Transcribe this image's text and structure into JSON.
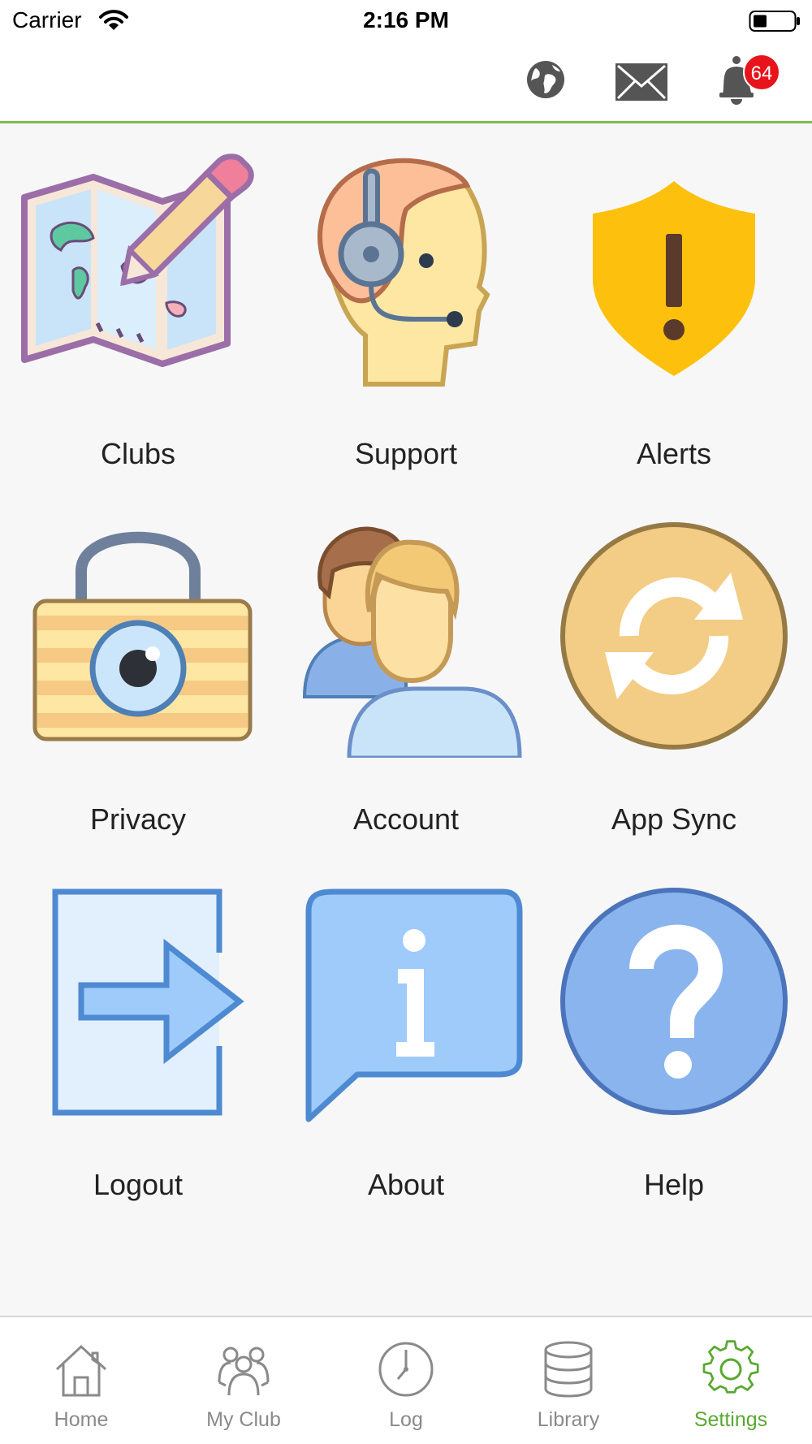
{
  "status_bar": {
    "carrier": "Carrier",
    "time": "2:16 PM"
  },
  "nav_bar": {
    "notification_count": "64",
    "accent_color": "#7cc04b",
    "badge_color": "#e8141b"
  },
  "menu": {
    "items": [
      {
        "label": "Clubs",
        "icon": "map-pencil-icon"
      },
      {
        "label": "Support",
        "icon": "headset-icon"
      },
      {
        "label": "Alerts",
        "icon": "shield-alert-icon"
      },
      {
        "label": "Privacy",
        "icon": "lock-eye-icon"
      },
      {
        "label": "Account",
        "icon": "users-icon"
      },
      {
        "label": "App Sync",
        "icon": "sync-icon"
      },
      {
        "label": "Logout",
        "icon": "logout-icon"
      },
      {
        "label": "About",
        "icon": "info-bubble-icon"
      },
      {
        "label": "Help",
        "icon": "help-icon"
      }
    ]
  },
  "tab_bar": {
    "items": [
      {
        "label": "Home",
        "icon": "home-icon",
        "active": false
      },
      {
        "label": "My Club",
        "icon": "group-icon",
        "active": false
      },
      {
        "label": "Log",
        "icon": "clock-icon",
        "active": false
      },
      {
        "label": "Library",
        "icon": "database-icon",
        "active": false
      },
      {
        "label": "Settings",
        "icon": "gear-icon",
        "active": true
      }
    ],
    "active_color": "#5aa832",
    "inactive_color": "#8a8a8a"
  }
}
